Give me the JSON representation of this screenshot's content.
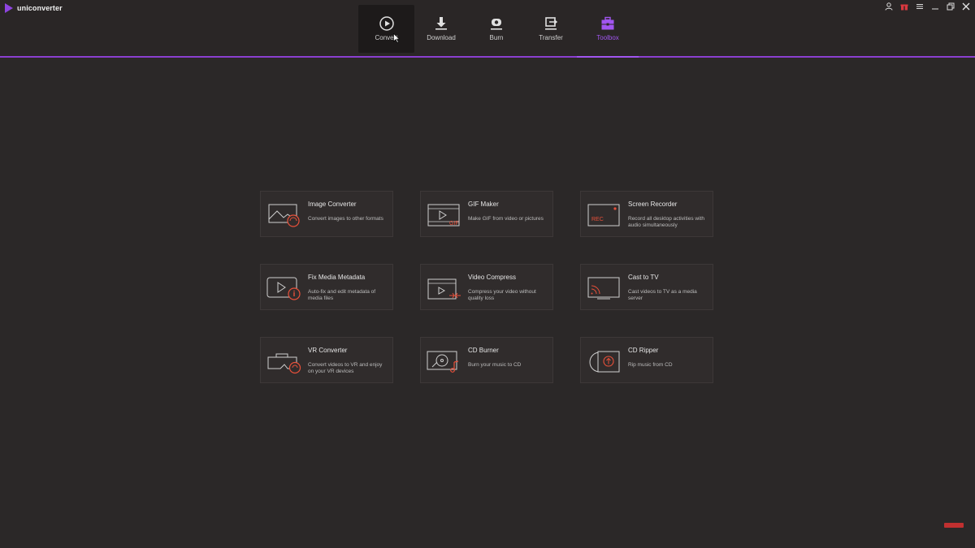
{
  "app": {
    "title": "uniconverter",
    "brand_color": "#8e44e0",
    "accent": "#a155f0"
  },
  "nav": {
    "tabs": [
      {
        "label": "Convert",
        "icon": "play-circle-icon"
      },
      {
        "label": "Download",
        "icon": "download-icon"
      },
      {
        "label": "Burn",
        "icon": "disc-icon"
      },
      {
        "label": "Transfer",
        "icon": "transfer-icon"
      },
      {
        "label": "Toolbox",
        "icon": "toolbox-icon"
      }
    ],
    "selected": "Toolbox",
    "hovered": "Convert"
  },
  "window_controls": [
    "user-icon",
    "gift-icon",
    "menu-icon",
    "minimize-icon",
    "restore-icon",
    "close-icon"
  ],
  "toolbox": {
    "tools": [
      {
        "title": "Image Converter",
        "desc": "Convert images to other formats",
        "icon": "image-convert-icon"
      },
      {
        "title": "GIF Maker",
        "desc": "Make GIF from video or pictures",
        "icon": "gif-icon"
      },
      {
        "title": "Screen Recorder",
        "desc": "Record all desktop activities with audio simultaneously",
        "icon": "screen-record-icon"
      },
      {
        "title": "Fix Media Metadata",
        "desc": "Auto-fix and edit metadata of media files",
        "icon": "metadata-icon"
      },
      {
        "title": "Video Compress",
        "desc": "Compress your video without quality loss",
        "icon": "compress-icon"
      },
      {
        "title": "Cast to TV",
        "desc": "Cast videos to TV as a media server",
        "icon": "cast-icon"
      },
      {
        "title": "VR Converter",
        "desc": "Convert videos to VR and enjoy on your VR devices",
        "icon": "vr-icon"
      },
      {
        "title": "CD Burner",
        "desc": "Burn your music to CD",
        "icon": "cd-burn-icon"
      },
      {
        "title": "CD Ripper",
        "desc": "Rip music from CD",
        "icon": "cd-rip-icon"
      }
    ]
  }
}
